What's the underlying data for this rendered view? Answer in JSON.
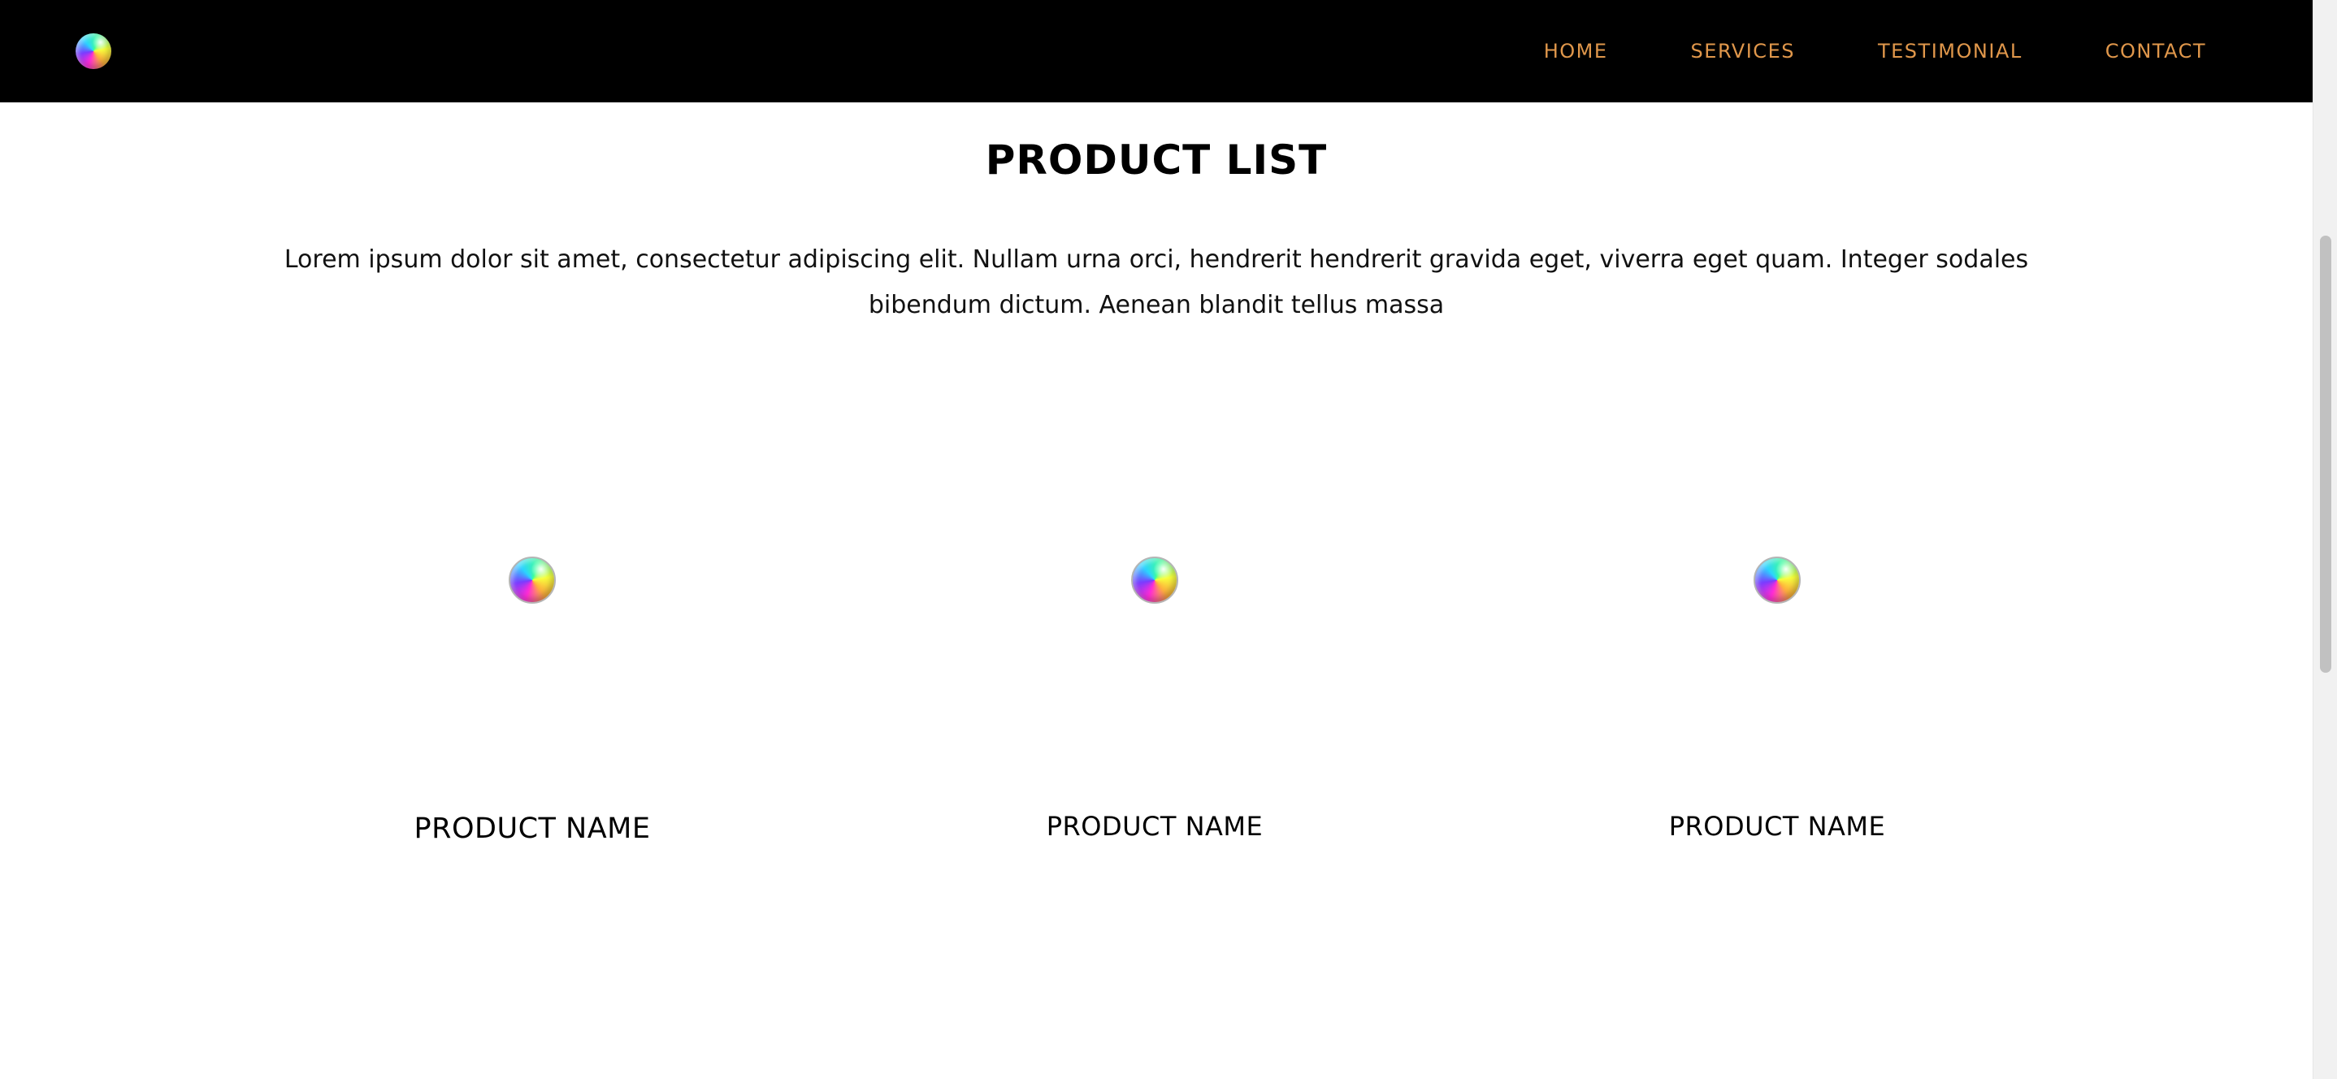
{
  "nav": {
    "logo_icon": "rainbow-orb-logo",
    "links": [
      "HOME",
      "SERVICES",
      "TESTIMONIAL",
      "CONTACT"
    ],
    "link_color": "#e0974b",
    "background": "#000000"
  },
  "main": {
    "title": "PRODUCT LIST",
    "intro": "Lorem ipsum dolor sit amet, consectetur adipiscing elit. Nullam urna orci, hendrerit hendrerit gravida eget, viverra eget quam. Integer sodales bibendum dictum. Aenean blandit tellus massa",
    "products": [
      {
        "name": "PRODUCT NAME",
        "image_icon": "rainbow-orb-image"
      },
      {
        "name": "PRODUCT NAME",
        "image_icon": "rainbow-orb-image"
      },
      {
        "name": "PRODUCT NAME",
        "image_icon": "rainbow-orb-image"
      }
    ]
  }
}
